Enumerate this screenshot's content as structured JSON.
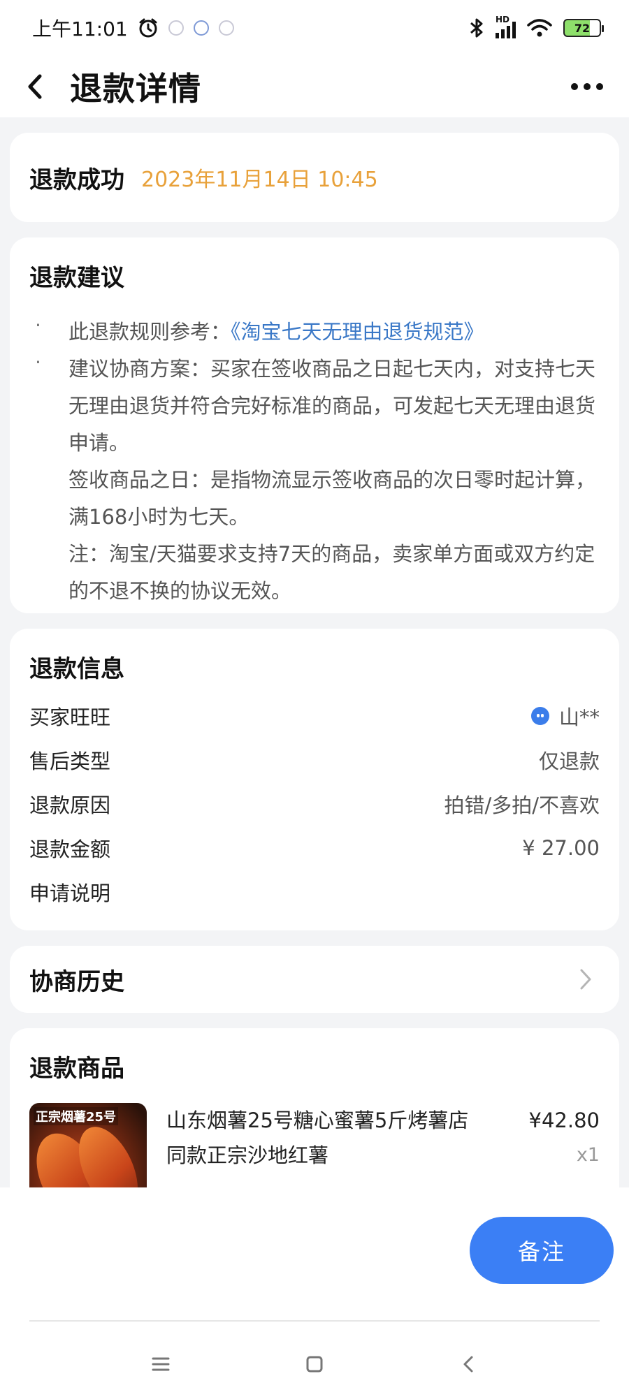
{
  "status_bar": {
    "time": "上午11:01",
    "battery": "72",
    "network_badge": "HD"
  },
  "header": {
    "title": "退款详情",
    "back_icon": "chevron-left-icon",
    "more_icon": "more-dots-icon"
  },
  "refund_status": {
    "label": "退款成功",
    "time": "2023年11月14日 10:45",
    "time_color": "#e8a13a"
  },
  "advice": {
    "title": "退款建议",
    "rule_prefix": "此退款规则参考：",
    "rule_link": "《淘宝七天无理由退货规范》",
    "paragraph_1": "建议协商方案：买家在签收商品之日起七天内，对支持七天无理由退货并符合完好标准的商品，可发起七天无理由退货申请。",
    "paragraph_2": "签收商品之日：是指物流显示签收商品的次日零时起计算，满168小时为七天。",
    "paragraph_3": "注：淘宝/天猫要求支持7天的商品，卖家单方面或双方约定的不退不换的协议无效。"
  },
  "refund_info": {
    "title": "退款信息",
    "rows": [
      {
        "label": "买家旺旺",
        "value": "山**"
      },
      {
        "label": "售后类型",
        "value": "仅退款"
      },
      {
        "label": "退款原因",
        "value": "拍错/多拍/不喜欢"
      },
      {
        "label": "退款金额",
        "value": "¥ 27.00"
      },
      {
        "label": "申请说明",
        "value": ""
      }
    ]
  },
  "history": {
    "title": "协商历史"
  },
  "goods": {
    "title": "退款商品",
    "thumb_tag": "正宗烟薯25号",
    "name": "山东烟薯25号糖心蜜薯5斤烤薯店同款正宗沙地红薯",
    "price": "¥42.80",
    "qty": "x1"
  },
  "actions": {
    "remark_label": "备注",
    "accent_color": "#3b7ff5"
  }
}
